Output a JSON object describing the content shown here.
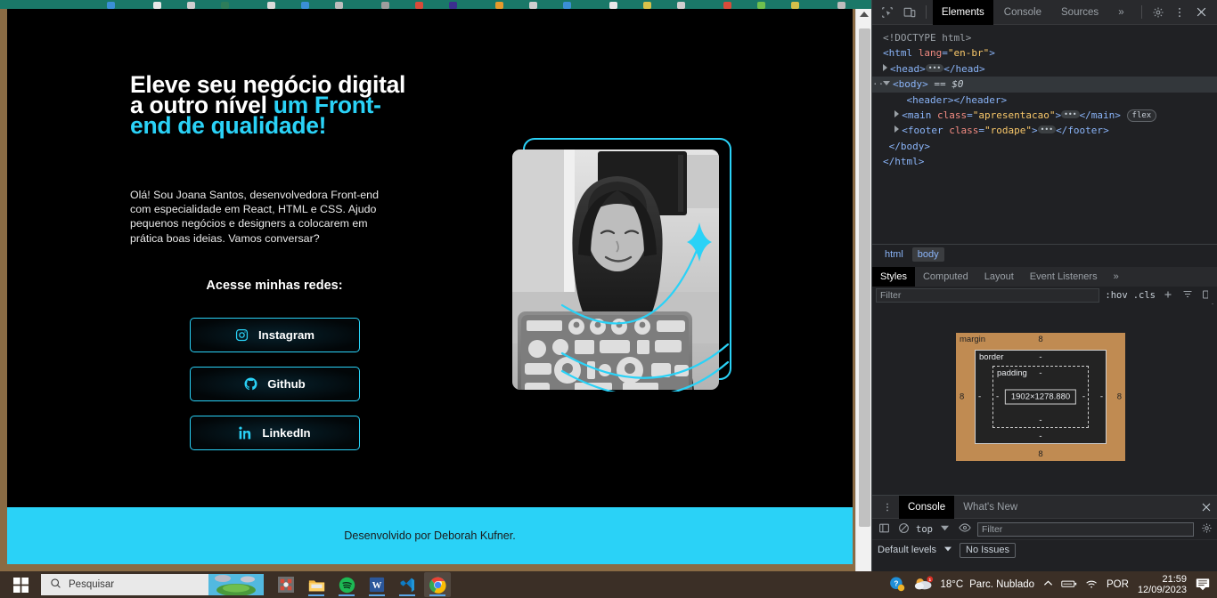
{
  "browser": {
    "tabstrip_color": "#1a7868"
  },
  "site": {
    "hero": {
      "title_line1": "Eleve seu negócio digital",
      "title_line2_white": "a outro nível ",
      "title_line2_accent": "um Front-",
      "title_line3_accent": "end de qualidade!",
      "paragraph": "Olá! Sou Joana Santos, desenvolvedora Front-end com especialidade em React, HTML e CSS. Ajudo pequenos negócios e designers a colocarem em prática boas ideias. Vamos conversar?",
      "accent_color": "#2ad2f7"
    },
    "social": {
      "heading": "Acesse minhas redes:",
      "buttons": [
        {
          "label": "Instagram",
          "icon": "instagram-icon"
        },
        {
          "label": "Github",
          "icon": "github-icon"
        },
        {
          "label": "LinkedIn",
          "icon": "linkedin-icon"
        }
      ]
    },
    "photo": {
      "alt": "Joana Santos sorrindo em frente a um notebook coberto de adesivos",
      "decoration": "cyan-arcs-and-sparkle"
    },
    "footer": {
      "text": "Desenvolvido por Deborah Kufner.",
      "background": "#2ad2f7"
    }
  },
  "devtools": {
    "toolbar": {
      "inspect_icon": "inspect-element-icon",
      "device_icon": "device-toolbar-icon",
      "tabs": [
        {
          "label": "Elements",
          "active": true
        },
        {
          "label": "Console",
          "active": false
        },
        {
          "label": "Sources",
          "active": false
        }
      ],
      "more_tabs": "»",
      "settings_icon": "gear-icon",
      "kebab_icon": "more-options-icon",
      "close_icon": "close-icon"
    },
    "dom": {
      "lines": [
        {
          "text": "<!DOCTYPE html>"
        },
        {
          "text": "<html lang=\"en-br\">"
        },
        {
          "text": "<head>…</head>"
        },
        {
          "text": "<body> == $0"
        },
        {
          "text": "<header></header>"
        },
        {
          "text": "<main class=\"apresentacao\">…</main>"
        },
        {
          "text": "<footer class=\"rodape\">…</footer>"
        },
        {
          "text": "</body>"
        },
        {
          "text": "</html>"
        }
      ],
      "doctype": "<!DOCTYPE html>",
      "html_tag": "html",
      "html_attr": "lang",
      "html_val": "\"en-br\"",
      "head_tag": "head",
      "body_tag": "body",
      "body_selected": "== $0",
      "header_tag": "header",
      "main_tag": "main",
      "main_attr": "class",
      "main_val": "\"apresentacao\"",
      "main_badge": "flex",
      "footer_tag": "footer",
      "footer_attr": "class",
      "footer_val": "\"rodape\""
    },
    "breadcrumb": [
      {
        "label": "html",
        "active": false
      },
      {
        "label": "body",
        "active": true
      }
    ],
    "styles_tabs": [
      {
        "label": "Styles",
        "active": true
      },
      {
        "label": "Computed",
        "active": false
      },
      {
        "label": "Layout",
        "active": false
      },
      {
        "label": "Event Listeners",
        "active": false
      }
    ],
    "styles_more": "»",
    "filter": {
      "placeholder": "Filter",
      "hov": ":hov",
      "cls": ".cls",
      "new_rule_icon": "add-rule-icon",
      "print_icon": "print-media-icon",
      "computed_icon": "computed-sidebar-icon"
    },
    "box_model": {
      "margin_label": "margin",
      "border_label": "border",
      "padding_label": "padding",
      "content": "1902×1278.880",
      "margin_top": "8",
      "margin_right": "8",
      "margin_bottom": "8",
      "margin_left": "8",
      "border_top": "-",
      "border_right": "-",
      "border_bottom": "-",
      "border_left": "-",
      "padding_top": "-",
      "padding_right": "-",
      "padding_bottom": "-",
      "padding_left": "-",
      "margin_color": "#c08b52"
    },
    "drawer": {
      "tabs": [
        {
          "label": "Console",
          "active": true
        },
        {
          "label": "What's New",
          "active": false
        }
      ],
      "kebab_icon": "drawer-more-icon",
      "close_icon": "drawer-close-icon",
      "sidebar_icon": "console-sidebar-icon",
      "clear_icon": "clear-console-icon",
      "context": "top",
      "eye_icon": "live-expression-icon",
      "filter_placeholder": "Filter",
      "settings_icon": "console-settings-icon",
      "levels": "Default levels",
      "issues": "No Issues"
    }
  },
  "taskbar": {
    "start_icon": "windows-start-icon",
    "search_placeholder": "Pesquisar",
    "search_icon": "search-icon",
    "apps": [
      {
        "name": "paint-3d-icon"
      },
      {
        "name": "file-explorer-icon"
      },
      {
        "name": "spotify-icon"
      },
      {
        "name": "word-icon"
      },
      {
        "name": "vs-code-icon"
      },
      {
        "name": "chrome-icon",
        "active": true
      }
    ],
    "help_icon": "help-icon",
    "weather_temp": "18°C",
    "weather_desc": "Parc. Nublado",
    "weather_icon": "partly-cloudy-icon",
    "chevron_icon": "show-hidden-icons-icon",
    "battery_icon": "battery-icon",
    "wifi_icon": "wifi-icon",
    "language": "POR",
    "time": "21:59",
    "date": "12/09/2023",
    "notification_icon": "notifications-icon"
  }
}
